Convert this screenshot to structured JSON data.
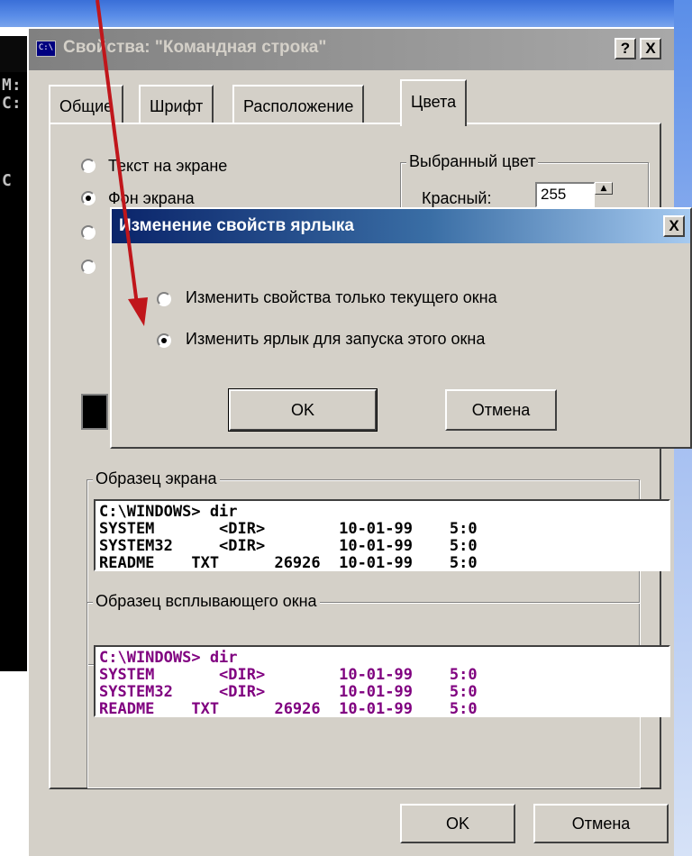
{
  "background_console": {
    "lines": [
      "M:",
      "C:",
      "C"
    ]
  },
  "window": {
    "title": "Свойства: \"Командная строка\"",
    "icon_text": "C:\\",
    "help_button": "?",
    "close_button": "X",
    "tabs": [
      {
        "label": "Общие",
        "active": false
      },
      {
        "label": "Шрифт",
        "active": false
      },
      {
        "label": "Расположение",
        "active": false
      },
      {
        "label": "Цвета",
        "active": true
      }
    ],
    "radios": [
      {
        "label": "Текст на экране",
        "checked": false
      },
      {
        "label": "Фон экрана",
        "checked": true
      },
      {
        "label": "",
        "checked": false
      },
      {
        "label": "",
        "checked": false
      }
    ],
    "selected_color": {
      "legend": "Выбранный цвет",
      "red_label": "Красный:",
      "red_value": "255"
    },
    "screen_sample": {
      "legend": "Образец экрана",
      "text_color": "#000000",
      "lines": [
        "C:\\WINDOWS> dir",
        "SYSTEM       <DIR>        10-01-99    5:0",
        "SYSTEM32     <DIR>        10-01-99    5:0",
        "README    TXT      26926  10-01-99    5:0"
      ]
    },
    "popup_sample": {
      "legend": "Образец всплывающего окна",
      "text_color": "#800080",
      "lines": [
        "C:\\WINDOWS> dir",
        "SYSTEM       <DIR>        10-01-99    5:0",
        "SYSTEM32     <DIR>        10-01-99    5:0",
        "README    TXT      26926  10-01-99    5:0"
      ]
    },
    "ok_label": "OK",
    "cancel_label": "Отмена"
  },
  "modal": {
    "title": "Изменение свойств ярлыка",
    "close_button": "X",
    "options": [
      {
        "label": "Изменить свойства только текущего окна",
        "checked": false
      },
      {
        "label": "Изменить ярлык для запуска этого окна",
        "checked": true
      }
    ],
    "ok_label": "OK",
    "cancel_label": "Отмена"
  },
  "annotation_arrow_color": "#c0161b"
}
